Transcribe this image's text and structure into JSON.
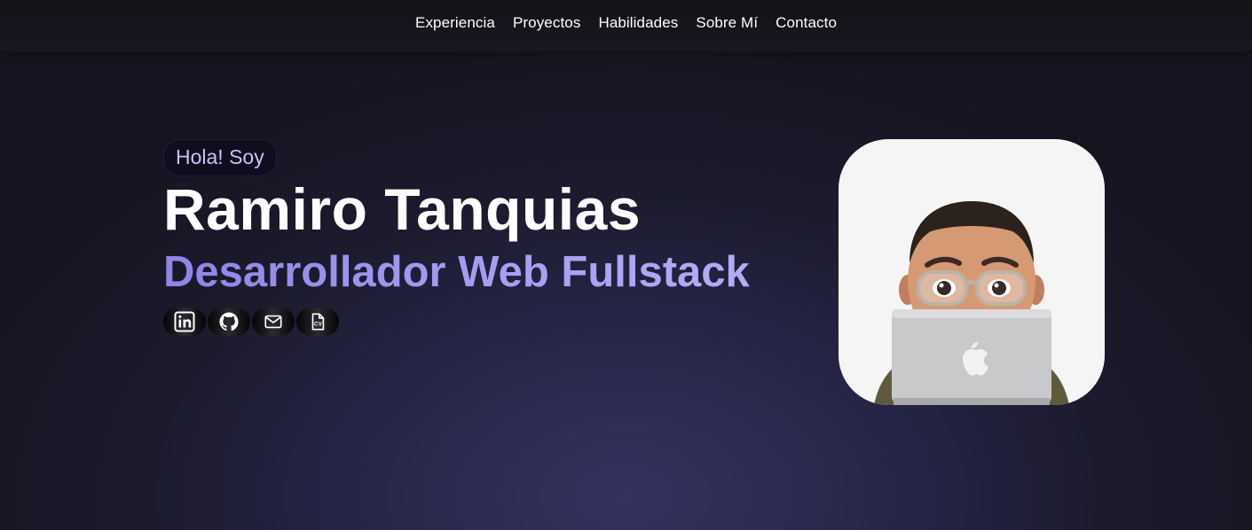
{
  "nav": {
    "items": [
      {
        "label": "Experiencia"
      },
      {
        "label": "Proyectos"
      },
      {
        "label": "Habilidades"
      },
      {
        "label": "Sobre Mí"
      },
      {
        "label": "Contacto"
      }
    ]
  },
  "hero": {
    "greeting": "Hola! Soy",
    "name": "Ramiro Tanquias",
    "role": "Desarrollador Web Fullstack"
  },
  "socials": [
    {
      "icon": "linkedin-icon"
    },
    {
      "icon": "github-icon"
    },
    {
      "icon": "mail-icon"
    },
    {
      "icon": "cv-document-icon",
      "text": "CV"
    }
  ],
  "avatar": {
    "icon": "memoji-avatar-with-laptop"
  },
  "colors": {
    "accent": "#a79cf2",
    "background": "#1c1b2e",
    "nav_background": "#141319",
    "badge_background": "#0f0e1f"
  }
}
